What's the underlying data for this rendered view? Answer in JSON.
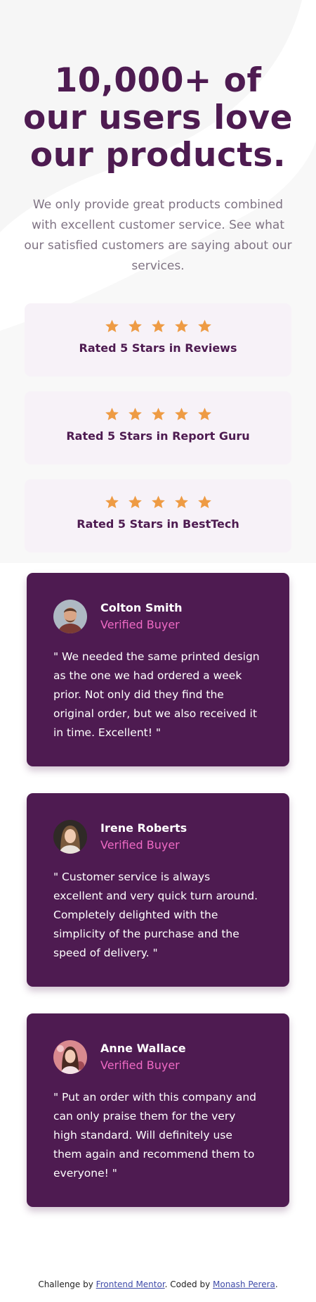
{
  "hero": {
    "title": "10,000+ of our users love our products.",
    "description": "We only provide great products combined with excellent customer service. See what our satisfied customers are saying about our services."
  },
  "colors": {
    "primary": "#4e1b51",
    "star": "#ee9b44",
    "accent_pink": "#ee6ac4",
    "rating_bg": "#f7f2f8"
  },
  "ratings": [
    {
      "label": "Rated 5 Stars in Reviews",
      "stars": 5
    },
    {
      "label": "Rated 5 Stars in Report Guru",
      "stars": 5
    },
    {
      "label": "Rated 5 Stars in BestTech",
      "stars": 5
    }
  ],
  "reviews": [
    {
      "name": "Colton Smith",
      "badge": "Verified Buyer",
      "quote": "\" We needed the same printed design as the one we had ordered a week prior. Not only did they find the original order, but we also received it in time. Excellent! \""
    },
    {
      "name": "Irene Roberts",
      "badge": "Verified Buyer",
      "quote": "\" Customer service is always excellent and very quick turn around. Completely delighted with the simplicity of the purchase and the speed of delivery. \""
    },
    {
      "name": "Anne Wallace",
      "badge": "Verified Buyer",
      "quote": "\" Put an order with this company and can only praise them for the very high standard. Will definitely use them again and recommend them to everyone! \""
    }
  ],
  "footer": {
    "prefix": "Challenge by",
    "link1": "Frontend Mentor",
    "middle": ". Coded by",
    "link2": "Monash Perera",
    "suffix": "."
  }
}
